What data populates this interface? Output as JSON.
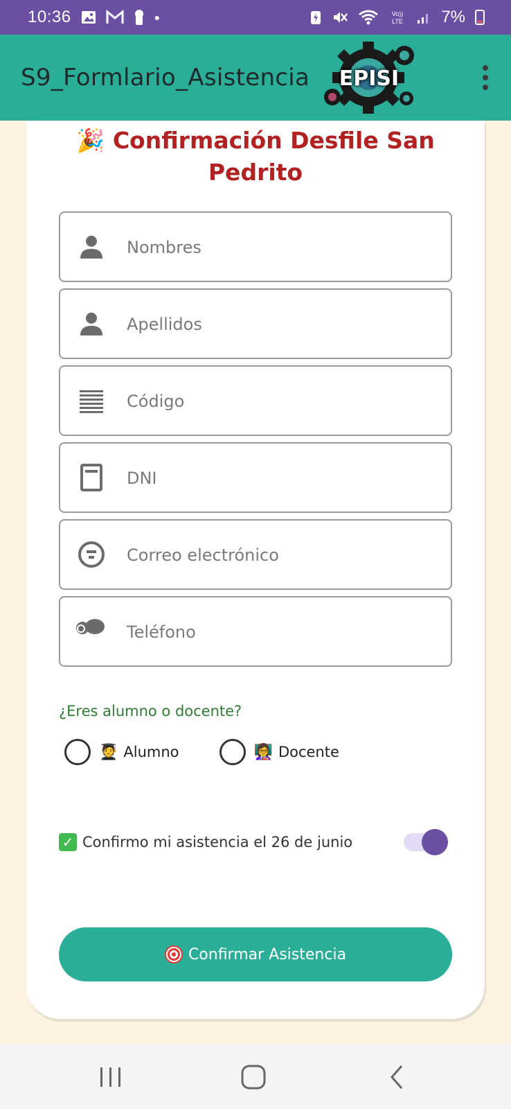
{
  "status_bar": {
    "time": "10:36",
    "left_icons": [
      "image-icon",
      "gmail-icon",
      "keyhole-icon",
      "dot-icon"
    ],
    "right_icons": [
      "data-saver-icon",
      "mute-icon",
      "wifi-icon",
      "volte-icon",
      "signal-icon"
    ],
    "volte_label": "VoLTE",
    "battery": "7%"
  },
  "app_bar": {
    "title": "S9_Formlario_Asistencia",
    "logo_text": "EPISI"
  },
  "form": {
    "title": "Confirmación Desfile San Pedrito",
    "title_emoji": "🎉",
    "fields": [
      {
        "placeholder": "Nombres",
        "icon": "person-icon"
      },
      {
        "placeholder": "Apellidos",
        "icon": "person-icon"
      },
      {
        "placeholder": "Código",
        "icon": "lines-icon"
      },
      {
        "placeholder": "DNI",
        "icon": "id-card-icon"
      },
      {
        "placeholder": "Correo electrónico",
        "icon": "email-icon"
      },
      {
        "placeholder": "Teléfono",
        "icon": "phone-icon"
      }
    ],
    "question": "¿Eres alumno o docente?",
    "options": [
      {
        "label": "Alumno",
        "emoji": "🧑‍🎓",
        "selected": false
      },
      {
        "label": "Docente",
        "emoji": "👩‍🏫",
        "selected": false
      }
    ],
    "confirm_label": "Confirmo mi asistencia el 26 de junio",
    "confirm_check": "✓",
    "switch_on": true,
    "submit_label": "Confirmar Asistencia"
  },
  "colors": {
    "status_bar": "#6A4FA3",
    "app_bar": "#2BAE98",
    "title": "#B22222",
    "question": "#2E7D32",
    "background": "#FDF1DF",
    "switch": "#6A4FA3"
  }
}
